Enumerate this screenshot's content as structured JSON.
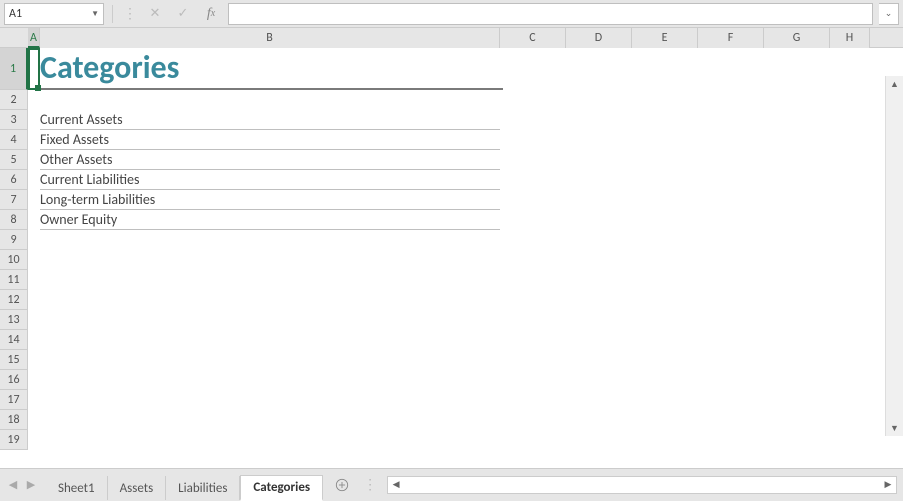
{
  "formula_bar": {
    "cell_ref": "A1",
    "formula": ""
  },
  "columns": [
    "A",
    "B",
    "C",
    "D",
    "E",
    "F",
    "G",
    "H"
  ],
  "active_column": "A",
  "active_row": 1,
  "row_count": 19,
  "sheet": {
    "title": "Categories",
    "categories": [
      "Current Assets",
      "Fixed Assets",
      "Other Assets",
      "Current Liabilities",
      "Long-term Liabilities",
      "Owner Equity"
    ]
  },
  "tabs": [
    {
      "label": "Sheet1",
      "active": false
    },
    {
      "label": "Assets",
      "active": false
    },
    {
      "label": "Liabilities",
      "active": false
    },
    {
      "label": "Categories",
      "active": true
    }
  ]
}
